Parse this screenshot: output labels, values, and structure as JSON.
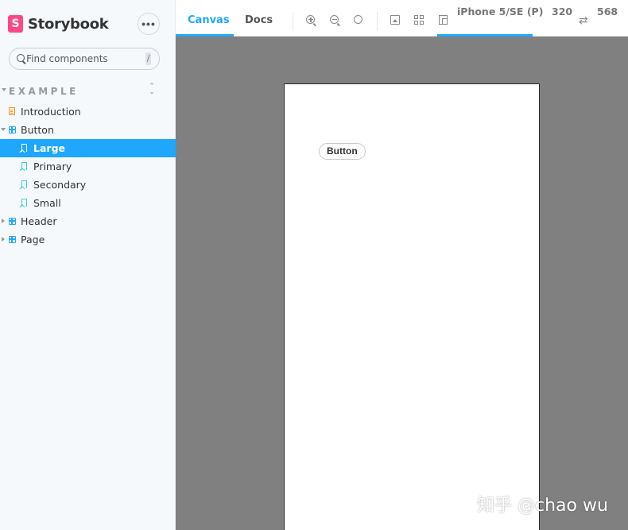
{
  "brand": {
    "name": "Storybook",
    "accent": "#ff4785"
  },
  "sidebar": {
    "menu_label": "•••",
    "search": {
      "placeholder": "Find components",
      "shortcut": "/"
    },
    "group": {
      "title": "EXAMPLE"
    },
    "items": [
      {
        "label": "Introduction",
        "type": "doc",
        "depth": 0
      },
      {
        "label": "Button",
        "type": "component",
        "depth": 0,
        "expanded": true
      },
      {
        "label": "Large",
        "type": "story",
        "depth": 1,
        "selected": true
      },
      {
        "label": "Primary",
        "type": "story",
        "depth": 1
      },
      {
        "label": "Secondary",
        "type": "story",
        "depth": 1
      },
      {
        "label": "Small",
        "type": "story",
        "depth": 1
      },
      {
        "label": "Header",
        "type": "component",
        "depth": 0
      },
      {
        "label": "Page",
        "type": "component",
        "depth": 0
      }
    ],
    "selected_color": "#1ea7fd"
  },
  "toolbar": {
    "tabs": [
      {
        "label": "Canvas",
        "active": true
      },
      {
        "label": "Docs",
        "active": false
      }
    ],
    "icons": [
      "zoom-in-icon",
      "zoom-out-icon",
      "zoom-reset-icon",
      "background-icon",
      "grid-icon",
      "viewport-icon"
    ],
    "viewport": {
      "label": "iPhone 5/SE (P)",
      "width": "320",
      "height": "568",
      "swap_glyph": "⇄"
    }
  },
  "preview": {
    "button_label": "Button",
    "canvas_bg": "#808080"
  },
  "watermark": "知乎 @chao wu"
}
